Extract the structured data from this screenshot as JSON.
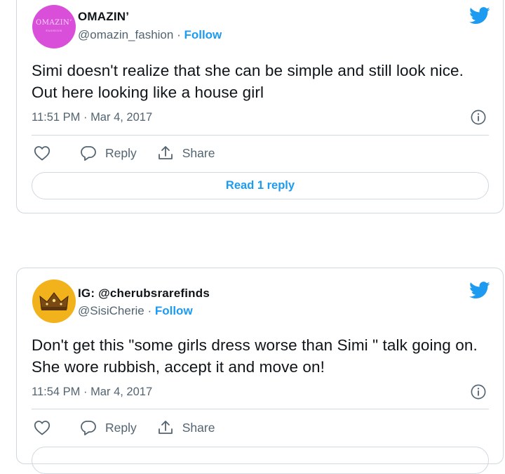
{
  "tweets": [
    {
      "name": "OMAZIN’",
      "handle": "@omazin_fashion",
      "separator": " · ",
      "follow": "Follow",
      "avatar_text": "OMAZIN’",
      "avatar_subtext": "FASHION",
      "text": "Simi doesn't realize that she can be simple and still look nice. Out here looking like a house girl",
      "time": "11:51 PM · Mar 4, 2017",
      "reply_label": "Reply",
      "share_label": "Share",
      "read_label": "Read 1 reply"
    },
    {
      "name": "IG: @cherubsrarefinds",
      "handle": "@SisiCherie",
      "separator": " · ",
      "follow": "Follow",
      "text": "Don't get this \"some girls dress worse than Simi \" talk going on. She wore rubbish, accept it and move on!",
      "time": "11:54 PM · Mar 4, 2017",
      "reply_label": "Reply",
      "share_label": "Share"
    }
  ],
  "colors": {
    "accent": "#1d9bf0",
    "muted": "#536471",
    "border": "#cfd9de",
    "avatar1": "#d94fd9",
    "avatar2": "#f2b21c"
  },
  "icons": [
    "twitter-bird-icon",
    "info-icon",
    "heart-icon",
    "reply-bubble-icon",
    "share-icon",
    "crown-icon"
  ]
}
